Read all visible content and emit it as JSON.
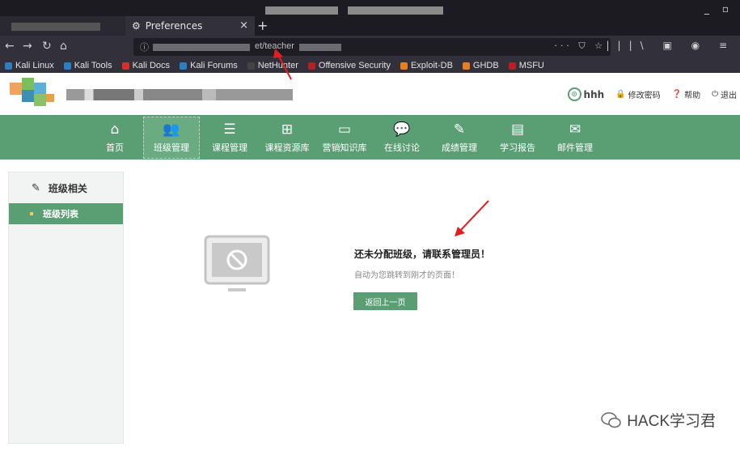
{
  "browser": {
    "tab_title": "Preferences",
    "tab_close": "×",
    "new_tab": "+",
    "window_buttons": "_ ▫",
    "url_visible": "et/teacher",
    "url_actions": "··· ⛉ ☆",
    "bookmarks": [
      {
        "label": "Kali Linux",
        "color": "#2b7ec1"
      },
      {
        "label": "Kali Tools",
        "color": "#2b7ec1"
      },
      {
        "label": "Kali Docs",
        "color": "#d0312d"
      },
      {
        "label": "Kali Forums",
        "color": "#2b7ec1"
      },
      {
        "label": "NetHunter",
        "color": "#444444"
      },
      {
        "label": "Offensive Security",
        "color": "#b22222"
      },
      {
        "label": "Exploit-DB",
        "color": "#e67e22"
      },
      {
        "label": "GHDB",
        "color": "#e67e22"
      },
      {
        "label": "MSFU",
        "color": "#b22222"
      }
    ]
  },
  "header": {
    "username": "hhh",
    "change_password": "修改密码",
    "help": "帮助",
    "logout": "退出"
  },
  "menu": [
    {
      "label": "首页",
      "icon": "home-icon",
      "glyph": "⌂"
    },
    {
      "label": "班级管理",
      "icon": "class-people-icon",
      "glyph": "👥",
      "active": true
    },
    {
      "label": "课程管理",
      "icon": "list-icon",
      "glyph": "☰"
    },
    {
      "label": "课程资源库",
      "icon": "sitemap-icon",
      "glyph": "⊞"
    },
    {
      "label": "营销知识库",
      "icon": "inbox-icon",
      "glyph": "▭"
    },
    {
      "label": "在线讨论",
      "icon": "chat-icon",
      "glyph": "💬"
    },
    {
      "label": "成绩管理",
      "icon": "grade-icon",
      "glyph": "✎"
    },
    {
      "label": "学习报告",
      "icon": "report-icon",
      "glyph": "▤"
    },
    {
      "label": "邮件管理",
      "icon": "mail-icon",
      "glyph": "✉"
    }
  ],
  "sidebar": {
    "heading": "班级相关",
    "items": [
      {
        "label": "班级列表"
      }
    ]
  },
  "main": {
    "message_title": "还未分配班级，请联系管理员！",
    "message_sub": "自动为您跳转到刚才的页面！",
    "back_button": "返回上一页"
  },
  "watermark": {
    "text": "HACK学习君"
  },
  "colors": {
    "brand_green": "#5a9e74",
    "chrome_dark": "#32303a",
    "sidebar_bg": "#f2f4f3"
  }
}
